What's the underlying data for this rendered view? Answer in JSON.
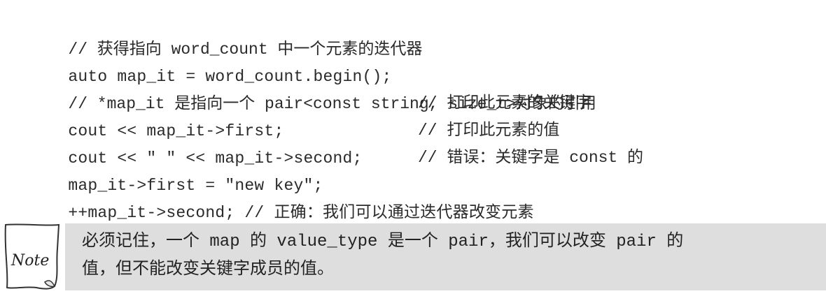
{
  "code_lines": [
    {
      "code": "",
      "comment": "// 获得指向 word_count 中一个元素的迭代器"
    },
    {
      "code": "auto map_it = word_count.begin();",
      "comment": ""
    },
    {
      "code": "",
      "comment": "// *map_it 是指向一个 pair<const string, size_t>对象的引用"
    },
    {
      "code": "cout << map_it->first;",
      "comment": "// 打印此元素的关键字"
    },
    {
      "code": "cout << \" \" << map_it->second;",
      "comment": "// 打印此元素的值"
    },
    {
      "code": "map_it->first = \"new key\";",
      "comment": "// 错误：关键字是 const 的"
    },
    {
      "code": "++map_it->second; // 正确：我们可以通过迭代器改变元素",
      "comment": ""
    }
  ],
  "note": {
    "icon_label": "Note",
    "line1": "必须记住，一个 map 的 value_type 是一个 pair，我们可以改变 pair 的",
    "line2": "值，但不能改变关键字成员的值。"
  }
}
